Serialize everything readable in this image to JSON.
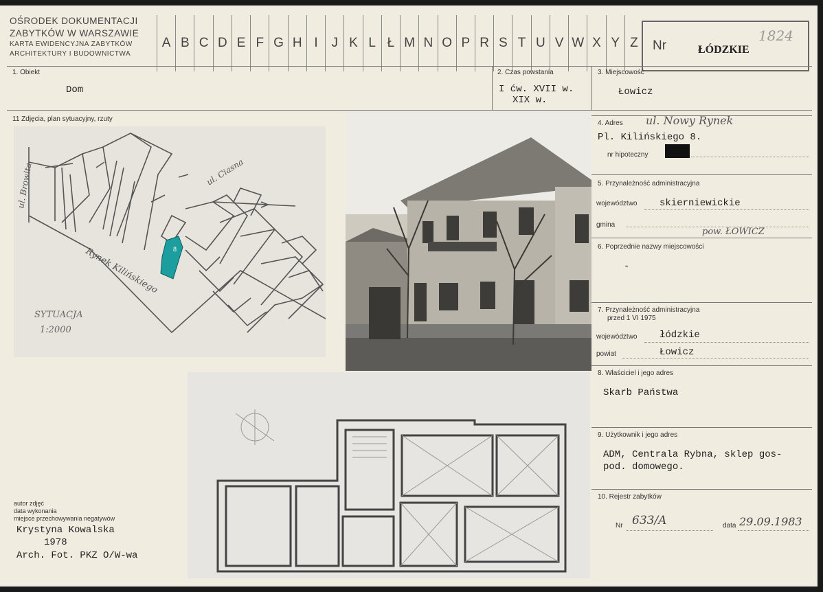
{
  "header": {
    "org_line1": "OŚRODEK DOKUMENTACJI",
    "org_line2": "ZABYTKÓW W WARSZAWIE",
    "org_line3": "KARTA EWIDENCYJNA ZABYTKÓW",
    "org_line4": "ARCHITEKTURY I BUDOWNICTWA",
    "letters": [
      "A",
      "B",
      "C",
      "D",
      "E",
      "F",
      "G",
      "H",
      "I",
      "J",
      "K",
      "L",
      "Ł",
      "M",
      "N",
      "O",
      "P",
      "R",
      "S",
      "T",
      "U",
      "V",
      "W",
      "X",
      "Y",
      "Z"
    ],
    "nr_label": "Nr",
    "voivodeship": "ŁÓDZKIE",
    "catalog_number": "1824"
  },
  "fields": {
    "obiekt_label": "1. Obiekt",
    "obiekt_value": "Dom",
    "czas_label": "2. Czas powstania",
    "czas_value_1": "I ćw. XVII w.",
    "czas_value_2": "XIX w.",
    "miejscowosc_label": "3. Miejscowość",
    "miejscowosc_value": "Łowicz",
    "zdjecia_label": "11 Zdjęcia, plan sytuacyjny, rzuty",
    "adres_label": "4. Adres",
    "adres_handwritten": "ul. Nowy Rynek",
    "adres_value": "Pl. Kilińskiego 8.",
    "hipoteczny_label": "nr hipoteczny",
    "przynaleznosc_label": "5. Przynależność administracyjna",
    "wojewodztwo_label": "województwo",
    "wojewodztwo_value": "skierniewickie",
    "gmina_label": "gmina",
    "gmina_handwritten": "pow. ŁOWICZ",
    "poprzednie_label": "6. Poprzednie nazwy miejscowości",
    "poprzednie_value": "-",
    "przed_label_1": "7. Przynależność administracyjna",
    "przed_label_2": "przed 1 VI 1975",
    "wojewodztwo2_label": "województwo",
    "wojewodztwo2_value": "łódzkie",
    "powiat_label": "powiat",
    "powiat_value": "Łowicz",
    "wlasciciel_label": "8. Właściciel i jego adres",
    "wlasciciel_value": "Skarb Państwa",
    "uzytkownik_label": "9. Użytkownik i jego adres",
    "uzytkownik_value_1": "ADM, Centrala Rybna, sklep gos-",
    "uzytkownik_value_2": "pod. domowego.",
    "rejestr_label": "10. Rejestr zabytków",
    "nr_label": "Nr",
    "nr_value": "633/A",
    "data_label": "data",
    "data_value": "29.09.1983"
  },
  "map": {
    "street_1": "ul. Browita",
    "street_2": "ul. Ciasna",
    "square": "Rynek Kilińskiego",
    "caption_1": "SYTUACJA",
    "caption_2": "1:2000",
    "plot_label": "8"
  },
  "credits": {
    "line1": "autor zdjęć",
    "line2": "data wykonania",
    "line3": "miejsce przechowywania negatywów",
    "author": "Krystyna Kowalska",
    "year": "1978",
    "archive": "Arch. Fot. PKZ O/W-wa"
  },
  "colors": {
    "card": "#f1ece0",
    "rule": "#777777",
    "highlight_plot": "#1d9e9e"
  }
}
